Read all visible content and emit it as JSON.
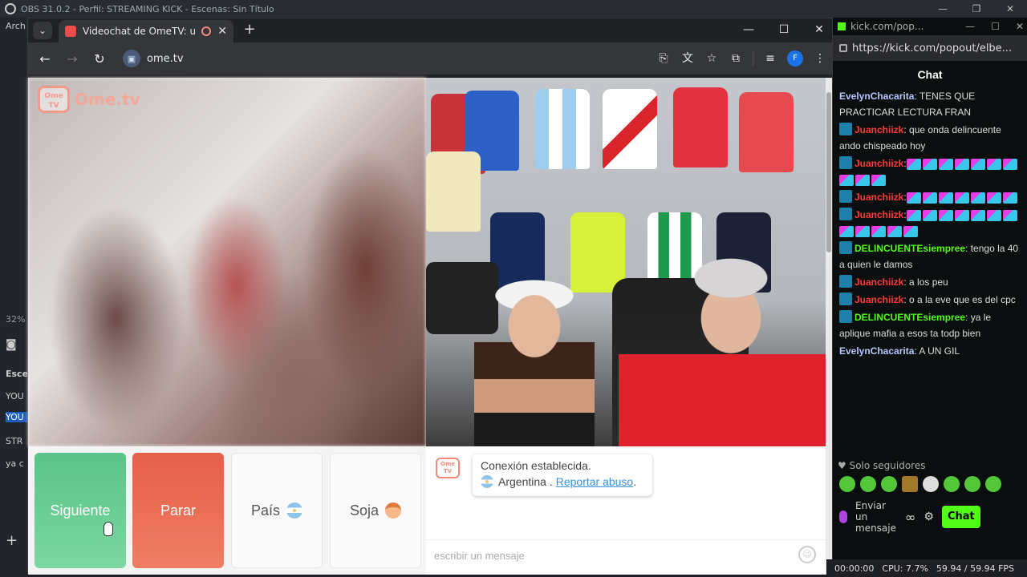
{
  "obs": {
    "title": "OBS 31.0.2 - Perfil: STREAMING KICK - Escenas: Sin Título",
    "menu_first": "Arch",
    "zoom": "32%",
    "scenes_label": "Esce",
    "scene_items": [
      "YOU",
      "YOU",
      "STR",
      "ya c"
    ],
    "add_button": "+",
    "status": {
      "time": "00:00:00",
      "cpu": "CPU: 7.7%",
      "fps": "59.94 / 59.94 FPS"
    }
  },
  "browser": {
    "tab_title": "Videochat de OmeTV: una a",
    "url": "ome.tv",
    "profile_initial": "F"
  },
  "ome": {
    "logo_box": "Ome TV",
    "logo_text": "Ome.tv",
    "buttons": {
      "next": "Siguiente",
      "stop": "Parar",
      "country": "País",
      "gender": "Soja"
    },
    "chat": {
      "status": "Conexión establecida.",
      "country": "Argentina .",
      "report": "Reportar abuso",
      "report_suffix": ".",
      "input_placeholder": "escribir un mensaje"
    }
  },
  "kick": {
    "window_title": "kick.com/pop...",
    "url": "https://kick.com/popout/elbe...",
    "header": "Chat",
    "messages": [
      {
        "user": "EvelynChacarita",
        "color": "blue",
        "badge": false,
        "text": ": TENES QUE PRACTICAR LECTURA FRAN",
        "emotes": 0
      },
      {
        "user": "Juanchiizk",
        "color": "red",
        "badge": true,
        "text": ": que onda delincuente ando chispeado hoy",
        "emotes": 0
      },
      {
        "user": "Juanchiizk",
        "color": "red",
        "badge": true,
        "text": ":",
        "emotes": 10
      },
      {
        "user": "Juanchiizk",
        "color": "red",
        "badge": true,
        "text": ":",
        "emotes": 7
      },
      {
        "user": "Juanchiizk",
        "color": "red",
        "badge": true,
        "text": ":",
        "emotes": 12
      },
      {
        "user": "DELINCUENTEsiempree",
        "color": "green",
        "badge": true,
        "text": ": tengo la 40 a quien le damos",
        "emotes": 0
      },
      {
        "user": "Juanchiizk",
        "color": "red",
        "badge": true,
        "text": ": a los peu",
        "emotes": 0
      },
      {
        "user": "Juanchiizk",
        "color": "red",
        "badge": true,
        "text": ": o a la eve que es del cpc",
        "emotes": 0
      },
      {
        "user": "DELINCUENTEsiempree",
        "color": "green",
        "badge": true,
        "text": ": ya le aplique mafia a esos ta todp bien",
        "emotes": 0
      },
      {
        "user": "EvelynChacarita",
        "color": "blue",
        "badge": false,
        "text": ": A UN GIL",
        "emotes": 0
      }
    ],
    "followers_only": "Solo seguidores",
    "send_placeholder": "Enviar un mensaje",
    "chat_button": "Chat"
  }
}
